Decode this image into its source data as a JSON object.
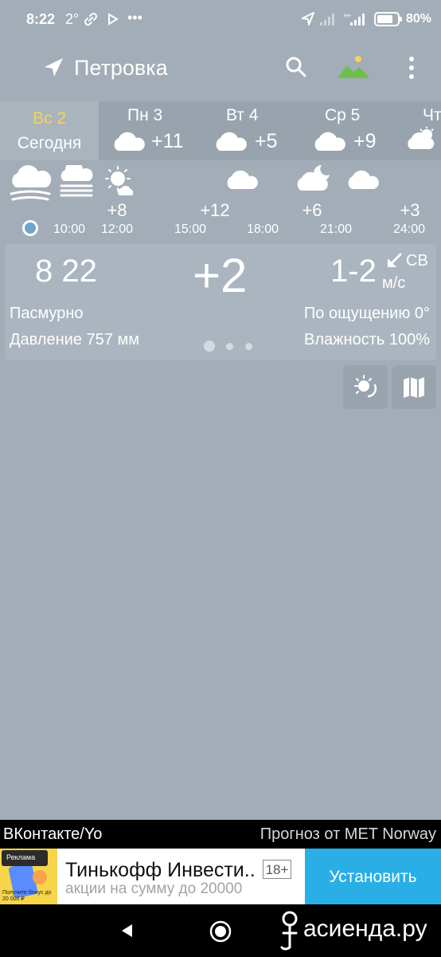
{
  "status_bar": {
    "time": "8:22",
    "temp": "2°",
    "battery": "80%"
  },
  "toolbar": {
    "location": "Петровка",
    "icons": [
      "navigation-arrow-icon",
      "search-icon",
      "landscape-icon",
      "more-vert-icon"
    ]
  },
  "days": [
    {
      "name": "Вс 2",
      "sub": "Сегодня",
      "selected": true
    },
    {
      "name": "Пн 3",
      "temp": "+11",
      "icon": "cloud-icon"
    },
    {
      "name": "Вт 4",
      "temp": "+5",
      "icon": "cloud-icon"
    },
    {
      "name": "Ср 5",
      "temp": "+9",
      "icon": "cloud-icon"
    },
    {
      "name": "Чт",
      "icon": "sun-cloud-icon"
    }
  ],
  "hourly": {
    "icons": [
      "fog-cloud-icon",
      "haze-icon",
      "sun-cloud-icon",
      "cloud-icon",
      "moon-cloud-icon",
      "cloud-icon"
    ],
    "temps": [
      "+8",
      "+12",
      "+6",
      "+3"
    ],
    "times": [
      "10:00",
      "12:00",
      "15:00",
      "18:00",
      "21:00",
      "24:00"
    ]
  },
  "current": {
    "time": "8 22",
    "temp": "+2",
    "wind_speed": "1-2",
    "wind_dir": "СВ",
    "wind_unit": "м/с",
    "condition": "Пасмурно",
    "feels_like": "По ощущению 0°",
    "pressure": "Давление 757 мм",
    "humidity": "Влажность 100%"
  },
  "credits": {
    "left": "ВКонтакте/Yo",
    "right": "Прогноз от MET Norway"
  },
  "ad": {
    "badge": "Реклама",
    "bonus": "Получите бонус до 20 000 ₽",
    "title": "Тинькофф Инвести..",
    "age": "18+",
    "subtitle": "акции на сумму до 20000",
    "button": "Установить"
  },
  "watermark": "асиенда.ру",
  "colors": {
    "background": "#a3adb7",
    "selected_day": "#f5d35a",
    "accent_blue": "#29aee6"
  }
}
